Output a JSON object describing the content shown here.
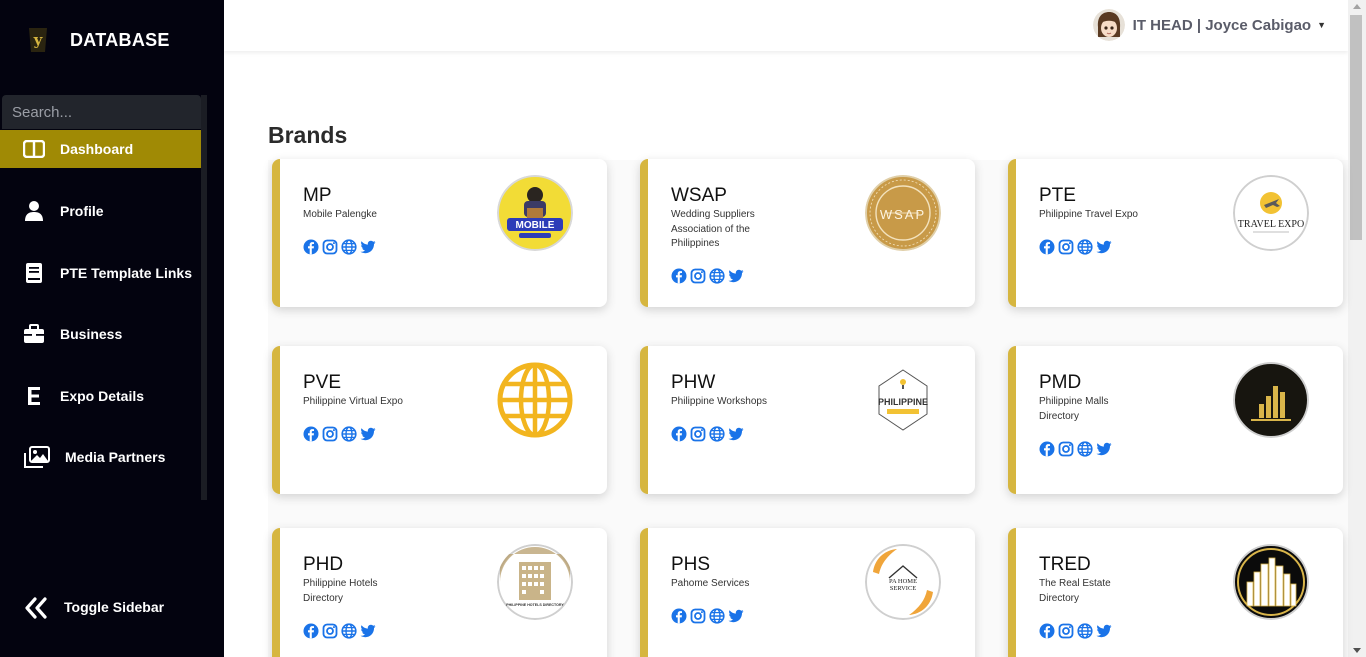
{
  "app": {
    "title": "DATABASE"
  },
  "search": {
    "placeholder": "Search..."
  },
  "sidebar": {
    "items": [
      {
        "label": "Dashboard"
      },
      {
        "label": "Profile"
      },
      {
        "label": "PTE Template Links"
      },
      {
        "label": "Business"
      },
      {
        "label": "Expo Details"
      },
      {
        "label": "Media Partners"
      }
    ],
    "toggle_label": "Toggle Sidebar"
  },
  "user": {
    "name": "IT HEAD | Joyce Cabigao"
  },
  "page": {
    "title": "Brands"
  },
  "brands": [
    {
      "code": "MP",
      "name": "Mobile Palengke",
      "logo_text": "MOBILE"
    },
    {
      "code": "WSAP",
      "name": "Wedding Suppliers Association of the Philippines",
      "logo_text": "WSAP"
    },
    {
      "code": "PTE",
      "name": "Philippine Travel Expo",
      "logo_text": "TRAVEL EXPO"
    },
    {
      "code": "PVE",
      "name": "Philippine Virtual Expo",
      "logo_text": ""
    },
    {
      "code": "PHW",
      "name": "Philippine Workshops",
      "logo_text": "PHILIPPINE"
    },
    {
      "code": "PMD",
      "name": "Philippine Malls Directory",
      "logo_text": ""
    },
    {
      "code": "PHD",
      "name": "Philippine Hotels Directory",
      "logo_text": "PHILIPPINE HOTELS DIRECTORY"
    },
    {
      "code": "PHS",
      "name": "Pahome Services",
      "logo_text": "PA HOME SERVICE"
    },
    {
      "code": "TRED",
      "name": "The Real Estate Directory",
      "logo_text": ""
    }
  ],
  "colors": {
    "sidebar_bg": "#03030f",
    "accent": "#a08a05",
    "card_border": "#d6b640",
    "social": "#1a73e8"
  }
}
